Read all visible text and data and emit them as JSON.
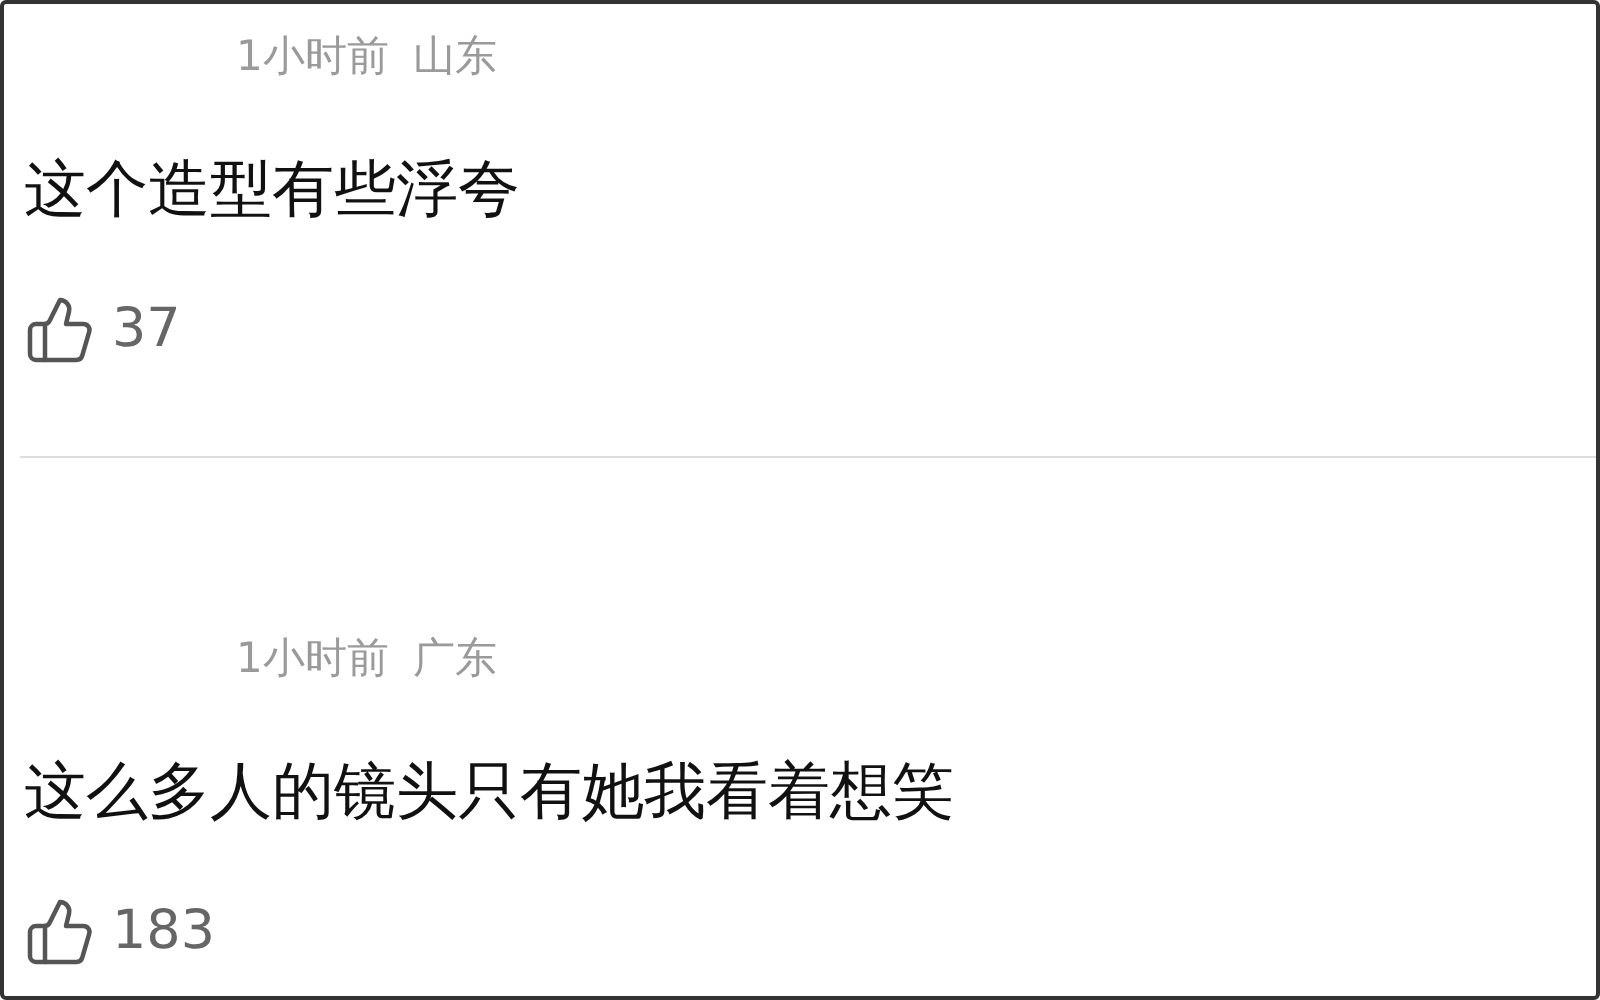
{
  "comments": [
    {
      "time": "1小时前",
      "location": "山东",
      "text": "这个造型有些浮夸",
      "likes": "37"
    },
    {
      "time": "1小时前",
      "location": "广东",
      "text": "这么多人的镜头只有她我看着想笑",
      "likes": "183"
    }
  ]
}
